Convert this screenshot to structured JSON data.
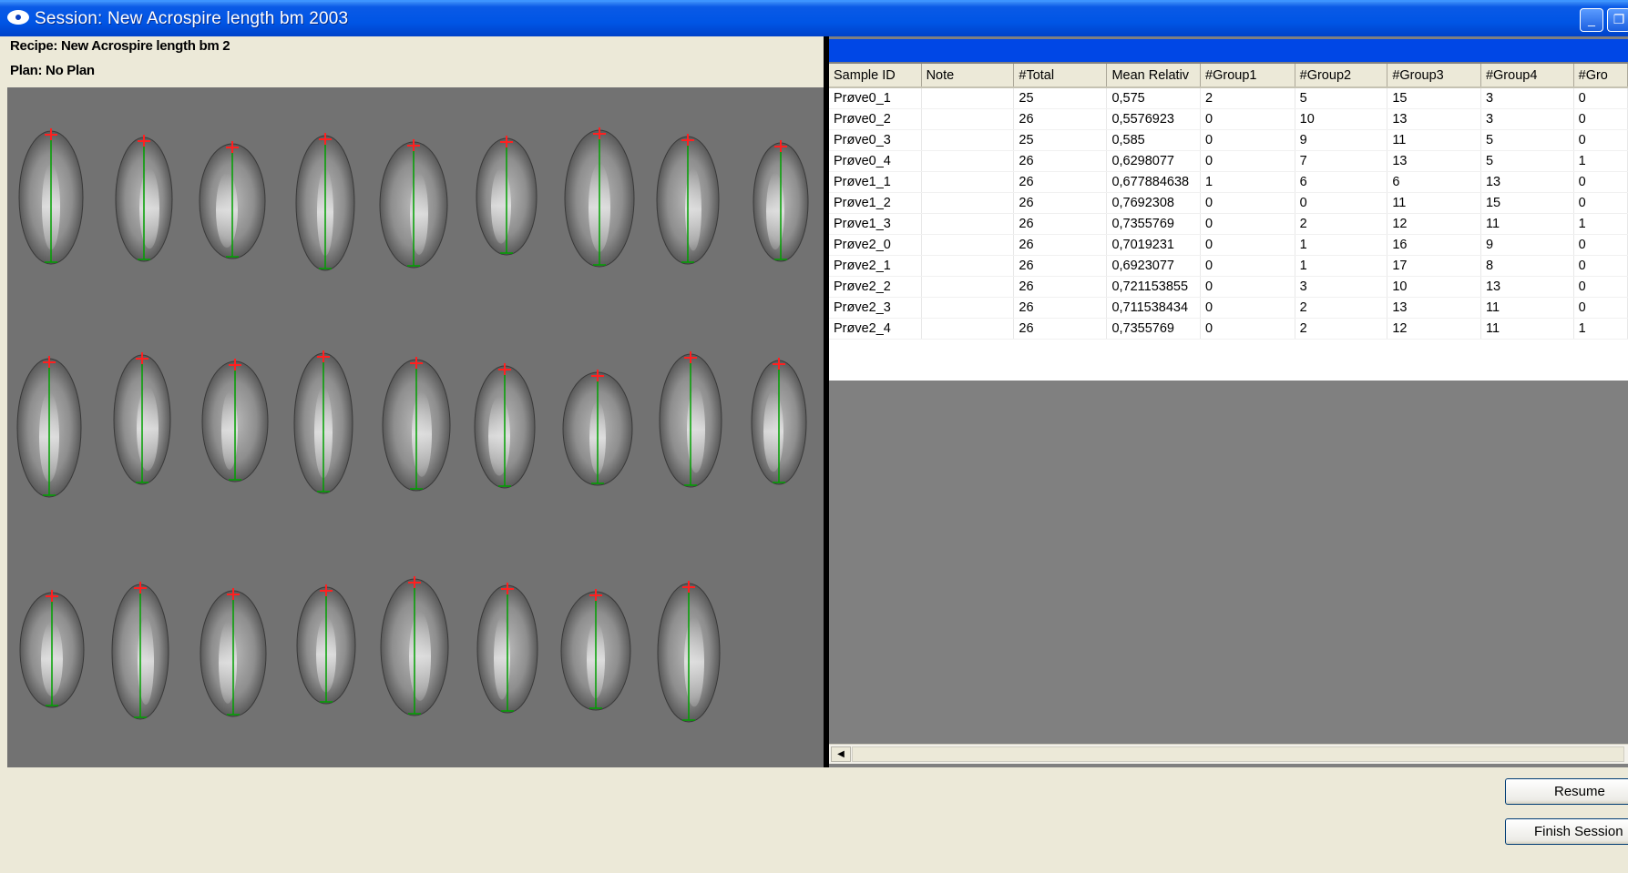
{
  "window": {
    "title": "Session: New Acrospire length bm 2003",
    "min_symbol": "_",
    "max_symbol": "❐"
  },
  "left": {
    "recipe": "Recipe: New Acrospire length bm 2",
    "plan": "Plan: No Plan"
  },
  "kernels": {
    "rows": [
      9,
      9,
      8
    ],
    "colors": {
      "top_marker": "#ff2020",
      "axis": "#00a000",
      "kernel": "#9a9a9a",
      "background": "#727272"
    }
  },
  "table": {
    "columns": [
      "Sample ID",
      "Note",
      "#Total",
      "Mean Relativ",
      "#Group1",
      "#Group2",
      "#Group3",
      "#Group4",
      "#Gro"
    ],
    "rows": [
      [
        "Prøve0_1",
        "",
        "25",
        "0,575",
        "2",
        "5",
        "15",
        "3",
        "0"
      ],
      [
        "Prøve0_2",
        "",
        "26",
        "0,5576923",
        "0",
        "10",
        "13",
        "3",
        "0"
      ],
      [
        "Prøve0_3",
        "",
        "25",
        "0,585",
        "0",
        "9",
        "11",
        "5",
        "0"
      ],
      [
        "Prøve0_4",
        "",
        "26",
        "0,6298077",
        "0",
        "7",
        "13",
        "5",
        "1"
      ],
      [
        "Prøve1_1",
        "",
        "26",
        "0,677884638",
        "1",
        "6",
        "6",
        "13",
        "0"
      ],
      [
        "Prøve1_2",
        "",
        "26",
        "0,7692308",
        "0",
        "0",
        "11",
        "15",
        "0"
      ],
      [
        "Prøve1_3",
        "",
        "26",
        "0,7355769",
        "0",
        "2",
        "12",
        "11",
        "1"
      ],
      [
        "Prøve2_0",
        "",
        "26",
        "0,7019231",
        "0",
        "1",
        "16",
        "9",
        "0"
      ],
      [
        "Prøve2_1",
        "",
        "26",
        "0,6923077",
        "0",
        "1",
        "17",
        "8",
        "0"
      ],
      [
        "Prøve2_2",
        "",
        "26",
        "0,721153855",
        "0",
        "3",
        "10",
        "13",
        "0"
      ],
      [
        "Prøve2_3",
        "",
        "26",
        "0,711538434",
        "0",
        "2",
        "13",
        "11",
        "0"
      ],
      [
        "Prøve2_4",
        "",
        "26",
        "0,7355769",
        "0",
        "2",
        "12",
        "11",
        "1"
      ]
    ]
  },
  "scroll": {
    "left_arrow": "◀"
  },
  "buttons": {
    "resume": "Resume",
    "finish": "Finish Session"
  },
  "colors": {
    "titlebar": "#0055e5",
    "dialog": "#ece9d8",
    "header_strip": "#0047e6",
    "empty_grid": "#808080"
  }
}
